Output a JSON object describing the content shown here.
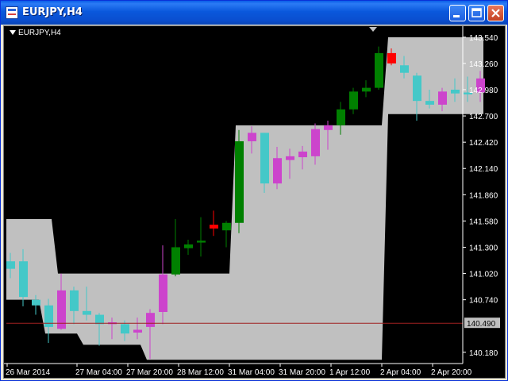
{
  "window": {
    "title": "EURJPY,H4",
    "chart_label": "EURJPY,H4"
  },
  "icons": {
    "app": "chart-window-icon",
    "minimize": "minimize-icon",
    "maximize": "maximize-icon",
    "close": "close-icon",
    "dropdown": "triangle-down-icon"
  },
  "colors": {
    "background": "#000000",
    "band": "#c0c0c0",
    "bull_candle": "#008000",
    "bear_candle": "#cc44cc",
    "teal_candle": "#44c8c8",
    "red_candle": "#ff0000",
    "price_line": "#a02020",
    "axis_text": "#ffffff"
  },
  "chart_data": {
    "type": "candlestick",
    "symbol": "EURJPY",
    "timeframe": "H4",
    "ylim": [
      140.06,
      143.64
    ],
    "y_ticks": [
      143.54,
      143.26,
      142.98,
      142.7,
      142.42,
      142.14,
      141.86,
      141.58,
      141.3,
      141.02,
      140.74,
      140.18
    ],
    "y_tick_labels": [
      "143.540",
      "143.260",
      "142.980",
      "142.700",
      "142.420",
      "142.140",
      "141.860",
      "141.580",
      "141.300",
      "141.020",
      "140.740",
      "140.180"
    ],
    "current_price": 140.49,
    "current_price_label": "140.490",
    "x_ticks": [
      {
        "bar": 0,
        "label": "26 Mar 2014"
      },
      {
        "bar": 5.5,
        "label": "27 Mar 04:00"
      },
      {
        "bar": 9.5,
        "label": "27 Mar 20:00"
      },
      {
        "bar": 13.5,
        "label": "28 Mar 12:00"
      },
      {
        "bar": 17.5,
        "label": "31 Mar 04:00"
      },
      {
        "bar": 21.5,
        "label": "31 Mar 20:00"
      },
      {
        "bar": 25.5,
        "label": "1 Apr 12:00"
      },
      {
        "bar": 29.5,
        "label": "2 Apr 04:00"
      },
      {
        "bar": 33.5,
        "label": "2 Apr 20:00"
      }
    ],
    "candles": [
      {
        "open": 141.07,
        "high": 141.24,
        "low": 140.97,
        "close": 141.15,
        "color": "teal"
      },
      {
        "open": 141.15,
        "high": 141.28,
        "low": 140.67,
        "close": 140.77,
        "color": "teal"
      },
      {
        "open": 140.74,
        "high": 140.79,
        "low": 140.58,
        "close": 140.68,
        "color": "teal"
      },
      {
        "open": 140.68,
        "high": 140.75,
        "low": 140.28,
        "close": 140.45,
        "color": "teal"
      },
      {
        "open": 140.43,
        "high": 141.02,
        "low": 140.42,
        "close": 140.84,
        "color": "magenta"
      },
      {
        "open": 140.84,
        "high": 140.88,
        "low": 140.48,
        "close": 140.62,
        "color": "teal"
      },
      {
        "open": 140.62,
        "high": 140.88,
        "low": 140.52,
        "close": 140.58,
        "color": "teal"
      },
      {
        "open": 140.58,
        "high": 140.6,
        "low": 140.25,
        "close": 140.48,
        "color": "teal"
      },
      {
        "open": 140.48,
        "high": 140.55,
        "low": 140.32,
        "close": 140.5,
        "color": "magenta"
      },
      {
        "open": 140.48,
        "high": 140.52,
        "low": 140.3,
        "close": 140.38,
        "color": "teal"
      },
      {
        "open": 140.39,
        "high": 140.55,
        "low": 140.32,
        "close": 140.42,
        "color": "magenta"
      },
      {
        "open": 140.45,
        "high": 140.64,
        "low": 140.11,
        "close": 140.6,
        "color": "magenta"
      },
      {
        "open": 140.61,
        "high": 141.32,
        "low": 140.48,
        "close": 141.01,
        "color": "magenta"
      },
      {
        "open": 141.01,
        "high": 141.6,
        "low": 140.99,
        "close": 141.3,
        "color": "green"
      },
      {
        "open": 141.29,
        "high": 141.38,
        "low": 141.22,
        "close": 141.33,
        "color": "green"
      },
      {
        "open": 141.35,
        "high": 141.62,
        "low": 141.2,
        "close": 141.37,
        "color": "green"
      },
      {
        "open": 141.5,
        "high": 141.69,
        "low": 141.42,
        "close": 141.54,
        "color": "red"
      },
      {
        "open": 141.48,
        "high": 141.58,
        "low": 141.3,
        "close": 141.56,
        "color": "green"
      },
      {
        "open": 141.56,
        "high": 142.55,
        "low": 141.45,
        "close": 142.43,
        "color": "green"
      },
      {
        "open": 142.43,
        "high": 142.59,
        "low": 142.3,
        "close": 142.52,
        "color": "magenta"
      },
      {
        "open": 142.52,
        "high": 142.52,
        "low": 141.88,
        "close": 141.98,
        "color": "teal"
      },
      {
        "open": 141.98,
        "high": 142.37,
        "low": 141.92,
        "close": 142.25,
        "color": "magenta"
      },
      {
        "open": 142.23,
        "high": 142.35,
        "low": 142.03,
        "close": 142.27,
        "color": "magenta"
      },
      {
        "open": 142.26,
        "high": 142.38,
        "low": 142.13,
        "close": 142.32,
        "color": "magenta"
      },
      {
        "open": 142.27,
        "high": 142.62,
        "low": 142.18,
        "close": 142.56,
        "color": "magenta"
      },
      {
        "open": 142.55,
        "high": 142.65,
        "low": 142.34,
        "close": 142.6,
        "color": "magenta"
      },
      {
        "open": 142.6,
        "high": 142.85,
        "low": 142.5,
        "close": 142.77,
        "color": "green"
      },
      {
        "open": 142.77,
        "high": 143.0,
        "low": 142.72,
        "close": 142.96,
        "color": "green"
      },
      {
        "open": 142.96,
        "high": 143.08,
        "low": 142.9,
        "close": 143.0,
        "color": "green"
      },
      {
        "open": 143.0,
        "high": 143.44,
        "low": 142.98,
        "close": 143.37,
        "color": "green"
      },
      {
        "open": 143.37,
        "high": 143.42,
        "low": 143.24,
        "close": 143.26,
        "color": "red"
      },
      {
        "open": 143.24,
        "high": 143.34,
        "low": 143.1,
        "close": 143.16,
        "color": "teal"
      },
      {
        "open": 143.13,
        "high": 143.16,
        "low": 142.65,
        "close": 142.86,
        "color": "teal"
      },
      {
        "open": 142.86,
        "high": 142.98,
        "low": 142.78,
        "close": 142.82,
        "color": "teal"
      },
      {
        "open": 142.82,
        "high": 143.0,
        "low": 142.75,
        "close": 142.96,
        "color": "magenta"
      },
      {
        "open": 142.94,
        "high": 143.1,
        "low": 142.85,
        "close": 142.98,
        "color": "teal"
      },
      {
        "open": 142.93,
        "high": 143.12,
        "low": 142.85,
        "close": 142.95,
        "color": "teal"
      },
      {
        "open": 142.95,
        "high": 143.18,
        "low": 142.85,
        "close": 143.1,
        "color": "magenta"
      }
    ],
    "band_upper": [
      141.6,
      141.6,
      141.6,
      141.6,
      141.02,
      141.02,
      141.02,
      141.02,
      141.02,
      141.02,
      141.02,
      141.02,
      141.02,
      141.02,
      141.02,
      141.02,
      141.02,
      141.02,
      142.6,
      142.6,
      142.6,
      142.6,
      142.6,
      142.6,
      142.6,
      142.6,
      142.6,
      142.6,
      142.6,
      142.6,
      143.54,
      143.54,
      143.54,
      143.54,
      143.54,
      143.54,
      143.54,
      143.54
    ],
    "band_lower": [
      140.74,
      140.74,
      140.74,
      140.38,
      140.38,
      140.38,
      140.26,
      140.26,
      140.26,
      140.26,
      140.26,
      140.1,
      140.1,
      140.1,
      140.1,
      140.1,
      140.1,
      140.1,
      140.1,
      140.1,
      140.1,
      140.1,
      140.1,
      140.1,
      140.1,
      140.1,
      140.1,
      140.1,
      140.1,
      140.1,
      142.72,
      142.72,
      142.72,
      142.72,
      142.72,
      142.72,
      142.72,
      142.72
    ]
  }
}
